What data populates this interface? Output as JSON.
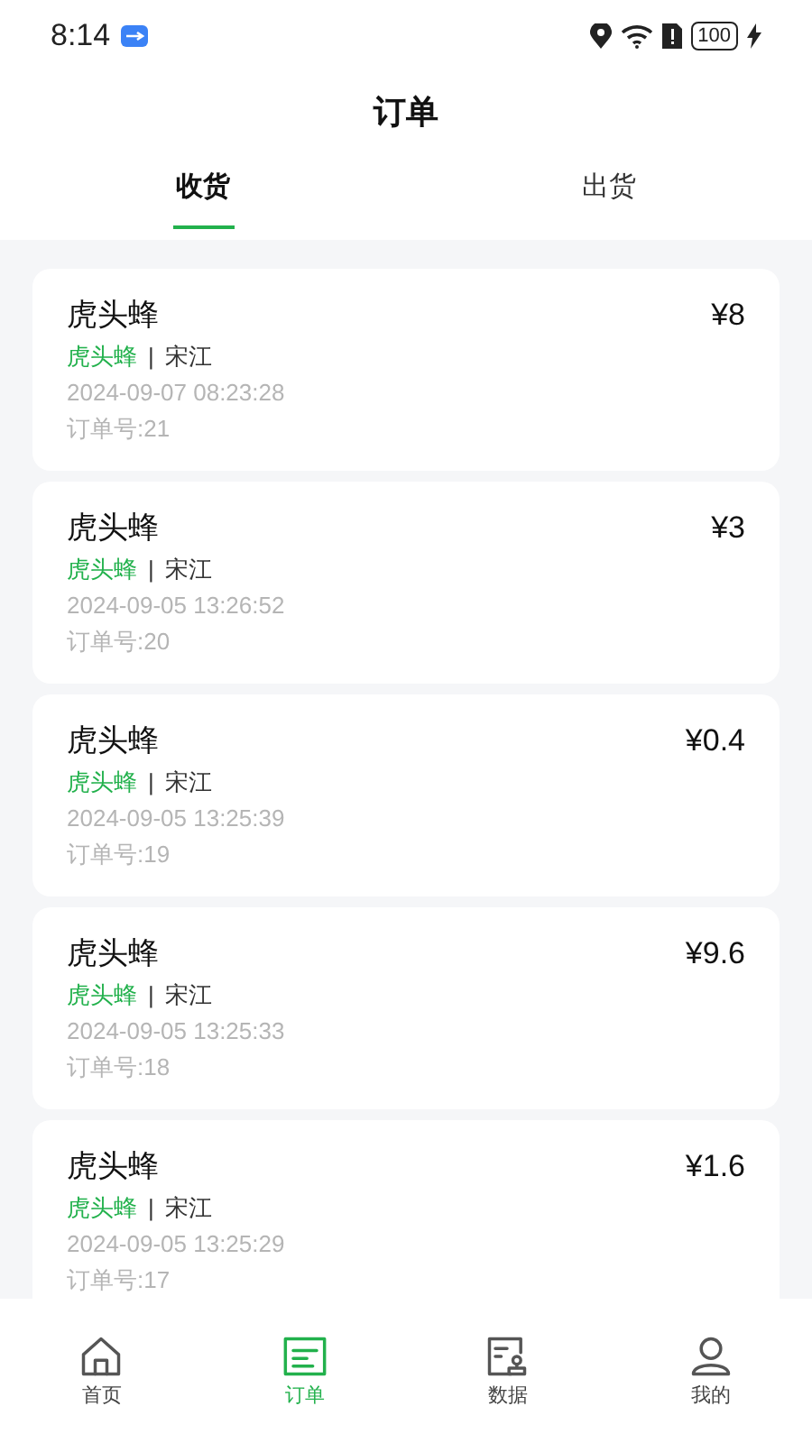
{
  "status_bar": {
    "time": "8:14",
    "battery": "100"
  },
  "title": "订单",
  "tabs": [
    {
      "label": "收货",
      "selected": true
    },
    {
      "label": "出货",
      "selected": false
    }
  ],
  "orders": [
    {
      "name": "虎头蜂",
      "price": "¥8",
      "category": "虎头蜂",
      "separator": "|",
      "person": "宋江",
      "time": "2024-09-07 08:23:28",
      "order_no": "订单号:21"
    },
    {
      "name": "虎头蜂",
      "price": "¥3",
      "category": "虎头蜂",
      "separator": "|",
      "person": "宋江",
      "time": "2024-09-05 13:26:52",
      "order_no": "订单号:20"
    },
    {
      "name": "虎头蜂",
      "price": "¥0.4",
      "category": "虎头蜂",
      "separator": "|",
      "person": "宋江",
      "time": "2024-09-05 13:25:39",
      "order_no": "订单号:19"
    },
    {
      "name": "虎头蜂",
      "price": "¥9.6",
      "category": "虎头蜂",
      "separator": "|",
      "person": "宋江",
      "time": "2024-09-05 13:25:33",
      "order_no": "订单号:18"
    },
    {
      "name": "虎头蜂",
      "price": "¥1.6",
      "category": "虎头蜂",
      "separator": "|",
      "person": "宋江",
      "time": "2024-09-05 13:25:29",
      "order_no": "订单号:17"
    }
  ],
  "bottom_nav": [
    {
      "kind": "home",
      "label": "首页",
      "selected": false
    },
    {
      "kind": "orders",
      "label": "订单",
      "selected": true
    },
    {
      "kind": "data",
      "label": "数据",
      "selected": false
    },
    {
      "kind": "profile",
      "label": "我的",
      "selected": false
    }
  ]
}
